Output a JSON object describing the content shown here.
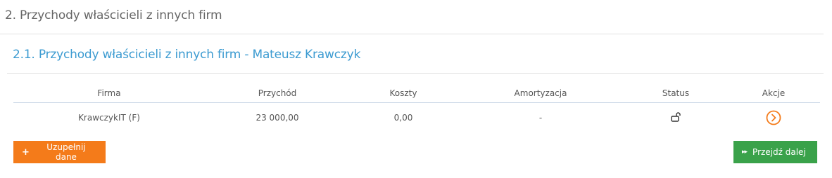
{
  "section": {
    "title": "2. Przychody właścicieli z innych firm"
  },
  "subsection": {
    "title": "2.1. Przychody właścicieli z innych firm - Mateusz Krawczyk"
  },
  "table": {
    "headers": {
      "firma": "Firma",
      "przychod": "Przychód",
      "koszty": "Koszty",
      "amortyzacja": "Amortyzacja",
      "status": "Status",
      "akcje": "Akcje"
    },
    "rows": [
      {
        "firma": "KrawczykIT (F)",
        "przychod": "23 000,00",
        "koszty": "0,00",
        "amortyzacja": "-",
        "status_icon": "unlocked-padlock-icon",
        "action_icon": "circle-chevron-right-icon"
      }
    ]
  },
  "buttons": {
    "fill_data": {
      "icon": "plus-icon",
      "label": "Uzupełnij dane"
    },
    "next": {
      "icon": "fast-forward-icon",
      "label": "Przejdź dalej"
    }
  },
  "colors": {
    "section_title": "#666666",
    "subsection_title": "#3c9bd1",
    "accent_orange": "#f47b1a",
    "accent_green": "#3aa24a",
    "header_border": "#c9d7e6"
  }
}
